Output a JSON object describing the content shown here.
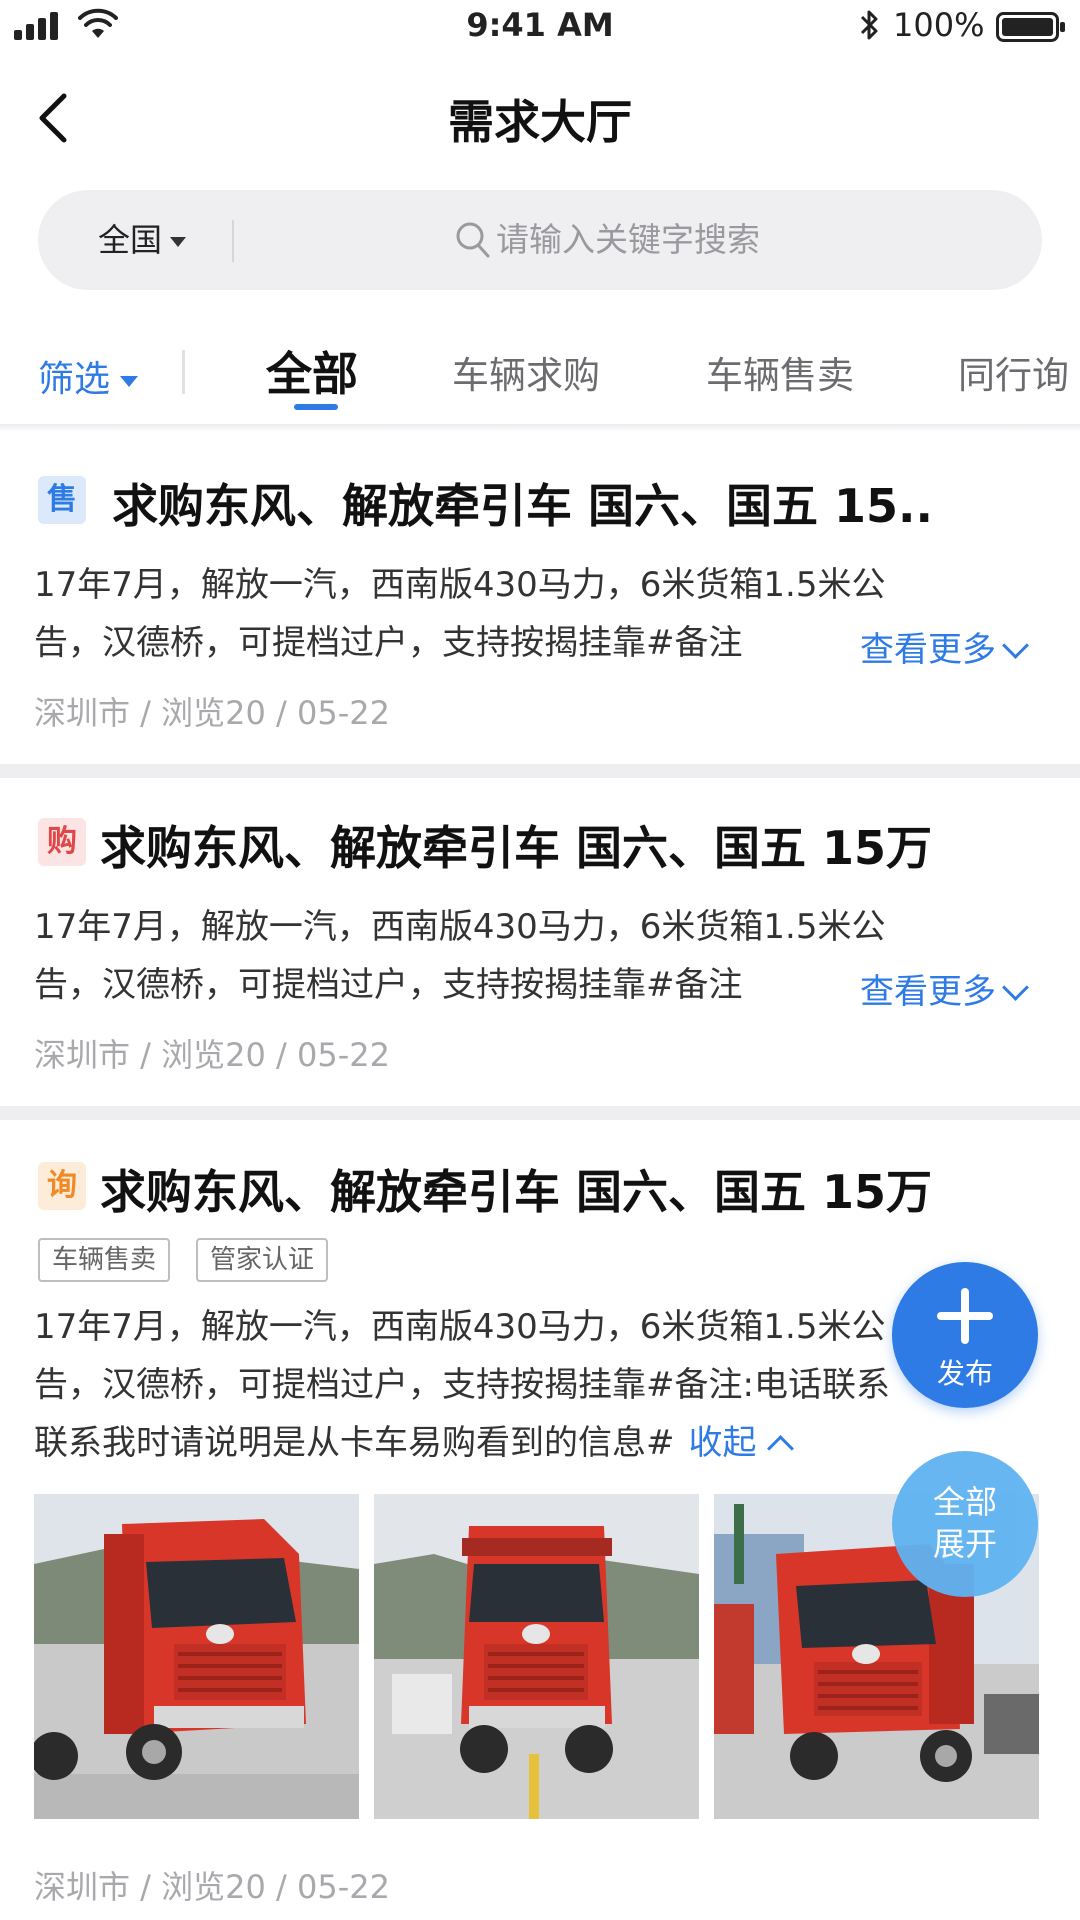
{
  "status_bar": {
    "time": "9:41 AM",
    "battery": "100%"
  },
  "nav": {
    "title": "需求大厅"
  },
  "search": {
    "region": "全国",
    "placeholder": "请输入关键字搜索"
  },
  "tabs": {
    "filter": "筛选",
    "items": [
      "全部",
      "车辆求购",
      "车辆售卖",
      "同行询"
    ],
    "active": "全部"
  },
  "cards": [
    {
      "badge": "售",
      "title": "求购东风、解放牵引车 国六、国五 15..",
      "desc_line1": "17年7月，解放一汽，西南版430马力，6米货箱1.5米公",
      "desc_line2": "告，汉德桥，可提档过户，支持按揭挂靠#备注",
      "more": "查看更多",
      "meta": "深圳市 / 浏览20 / 05-22"
    },
    {
      "badge": "购",
      "title": "求购东风、解放牵引车 国六、国五 15万",
      "desc_line1": "17年7月，解放一汽，西南版430马力，6米货箱1.5米公",
      "desc_line2": "告，汉德桥，可提档过户，支持按揭挂靠#备注",
      "more": "查看更多",
      "meta": "深圳市 / 浏览20 / 05-22"
    },
    {
      "badge": "询",
      "title": "求购东风、解放牵引车 国六、国五 15万",
      "tags": [
        "车辆售卖",
        "管家认证"
      ],
      "desc_line1": "17年7月，解放一汽，西南版430马力，6米货箱1.5米公",
      "desc_line2": "告，汉德桥，可提档过户，支持按揭挂靠#备注:电话联系",
      "desc_line3": "联系我时请说明是从卡车易购看到的信息#",
      "collapse": "收起",
      "meta": "深圳市 / 浏览20 / 05-22"
    }
  ],
  "fab": {
    "publish": "发布",
    "expand_line1": "全部",
    "expand_line2": "展开"
  },
  "colors": {
    "accent": "#2e7be6",
    "sell_badge": "#dbe9fb",
    "buy_badge": "#fde4e4",
    "ask_badge": "#fdecd9"
  }
}
